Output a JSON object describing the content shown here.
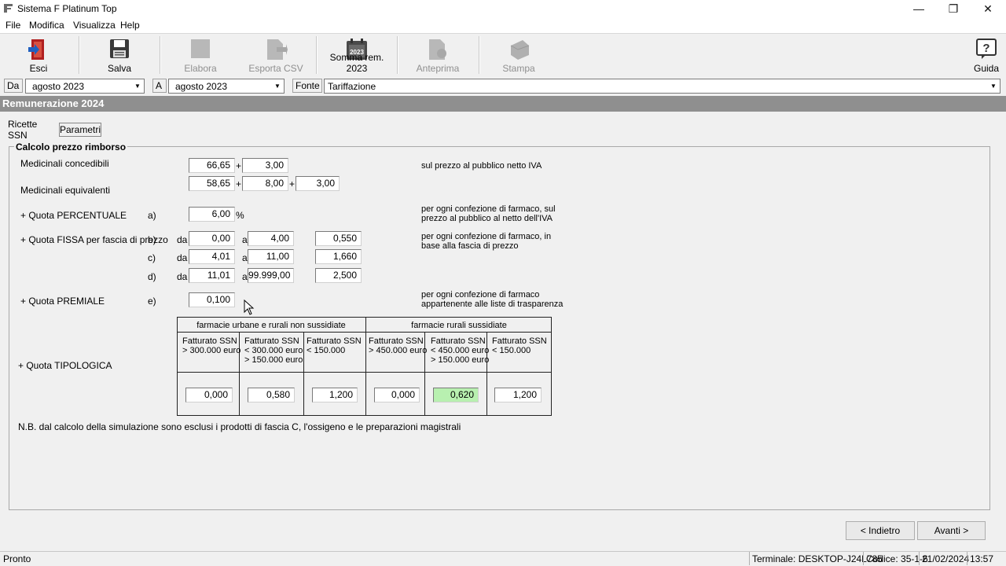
{
  "window": {
    "title": "Sistema F Platinum Top",
    "minimize": "—",
    "restore": "❐",
    "close": "✕"
  },
  "menu": [
    "File",
    "Modifica",
    "Visualizza",
    "Help"
  ],
  "toolbar": {
    "esci": "Esci",
    "salva": "Salva",
    "elabora": "Elabora",
    "esporta": "Esporta CSV",
    "somma": "Somma rem. 2023",
    "somma_icon_year": "2023",
    "anteprima": "Anteprima",
    "stampa": "Stampa",
    "guida": "Guida"
  },
  "filter": {
    "da_label": "Da",
    "da_value": "agosto   2023",
    "a_label": "A",
    "a_value": "agosto   2023",
    "fonte_label": "Fonte",
    "fonte_value": "Tariffazione"
  },
  "section_title": "Remunerazione 2024",
  "tabs": [
    "Ricette SSN",
    "Parametri"
  ],
  "group_title": "Calcolo prezzo rimborso",
  "concedibili": {
    "label": "Medicinali concedibili",
    "v1": "66,65",
    "v2": "3,00",
    "note": "sul prezzo al pubblico netto IVA"
  },
  "equivalenti": {
    "label": "Medicinali equivalenti",
    "v1": "58,65",
    "v2": "8,00",
    "v3": "3,00"
  },
  "plus": "+",
  "percentuale": {
    "label": "+ Quota PERCENTUALE",
    "letter": "a)",
    "value": "6,00",
    "unit": "%",
    "note1": "per ogni confezione di farmaco, sul",
    "note2": "prezzo al pubblico al netto dell'IVA"
  },
  "fissa": {
    "label": "+ Quota FISSA per fascia di prezzo",
    "da": "da",
    "a": "a",
    "note1": "per ogni confezione di farmaco, in",
    "note2": "base alla fascia di prezzo",
    "rows": [
      {
        "letter": "b)",
        "from": "0,00",
        "to": "4,00",
        "value": "0,550"
      },
      {
        "letter": "c)",
        "from": "4,01",
        "to": "11,00",
        "value": "1,660"
      },
      {
        "letter": "d)",
        "from": "11,01",
        "to": "99.999,00",
        "value": "2,500"
      }
    ]
  },
  "premiale": {
    "label": "+ Quota PREMIALE",
    "letter": "e)",
    "value": "0,100",
    "note1": "per ogni confezione di farmaco",
    "note2": "appartenente alle liste di trasparenza"
  },
  "tipologica": {
    "label": "+ Quota TIPOLOGICA",
    "group1": "farmacie urbane e rurali non sussidiate",
    "group2": "farmacie rurali sussidiate",
    "cols": [
      {
        "l1": "Fatturato SSN",
        "l2": "> 300.000 euro",
        "l3": "",
        "value": "0,000"
      },
      {
        "l1": "Fatturato SSN",
        "l2": "< 300.000 euro",
        "l3": "> 150.000 euro",
        "value": "0,580"
      },
      {
        "l1": "Fatturato SSN",
        "l2": "< 150.000",
        "l3": "",
        "value": "1,200"
      },
      {
        "l1": "Fatturato SSN",
        "l2": "> 450.000 euro",
        "l3": "",
        "value": "0,000"
      },
      {
        "l1": "Fatturato SSN",
        "l2": "< 450.000 euro",
        "l3": "> 150.000 euro",
        "value": "0,620"
      },
      {
        "l1": "Fatturato SSN",
        "l2": "< 150.000",
        "l3": "",
        "value": "1,200"
      }
    ]
  },
  "nb": "N.B. dal calcolo della simulazione sono esclusi i prodotti di fascia C, l'ossigeno e le preparazioni magistrali",
  "buttons": {
    "back": "< Indietro",
    "next": "Avanti >"
  },
  "status": {
    "left": "Pronto",
    "terminal": "Terminale: DESKTOP-J24L785",
    "code": "Codice: 35-1-6",
    "date": "21/02/2024",
    "time": "13:57"
  },
  "colors": {
    "header": "#8f8f8f",
    "highlight": "#b8f0b0"
  }
}
